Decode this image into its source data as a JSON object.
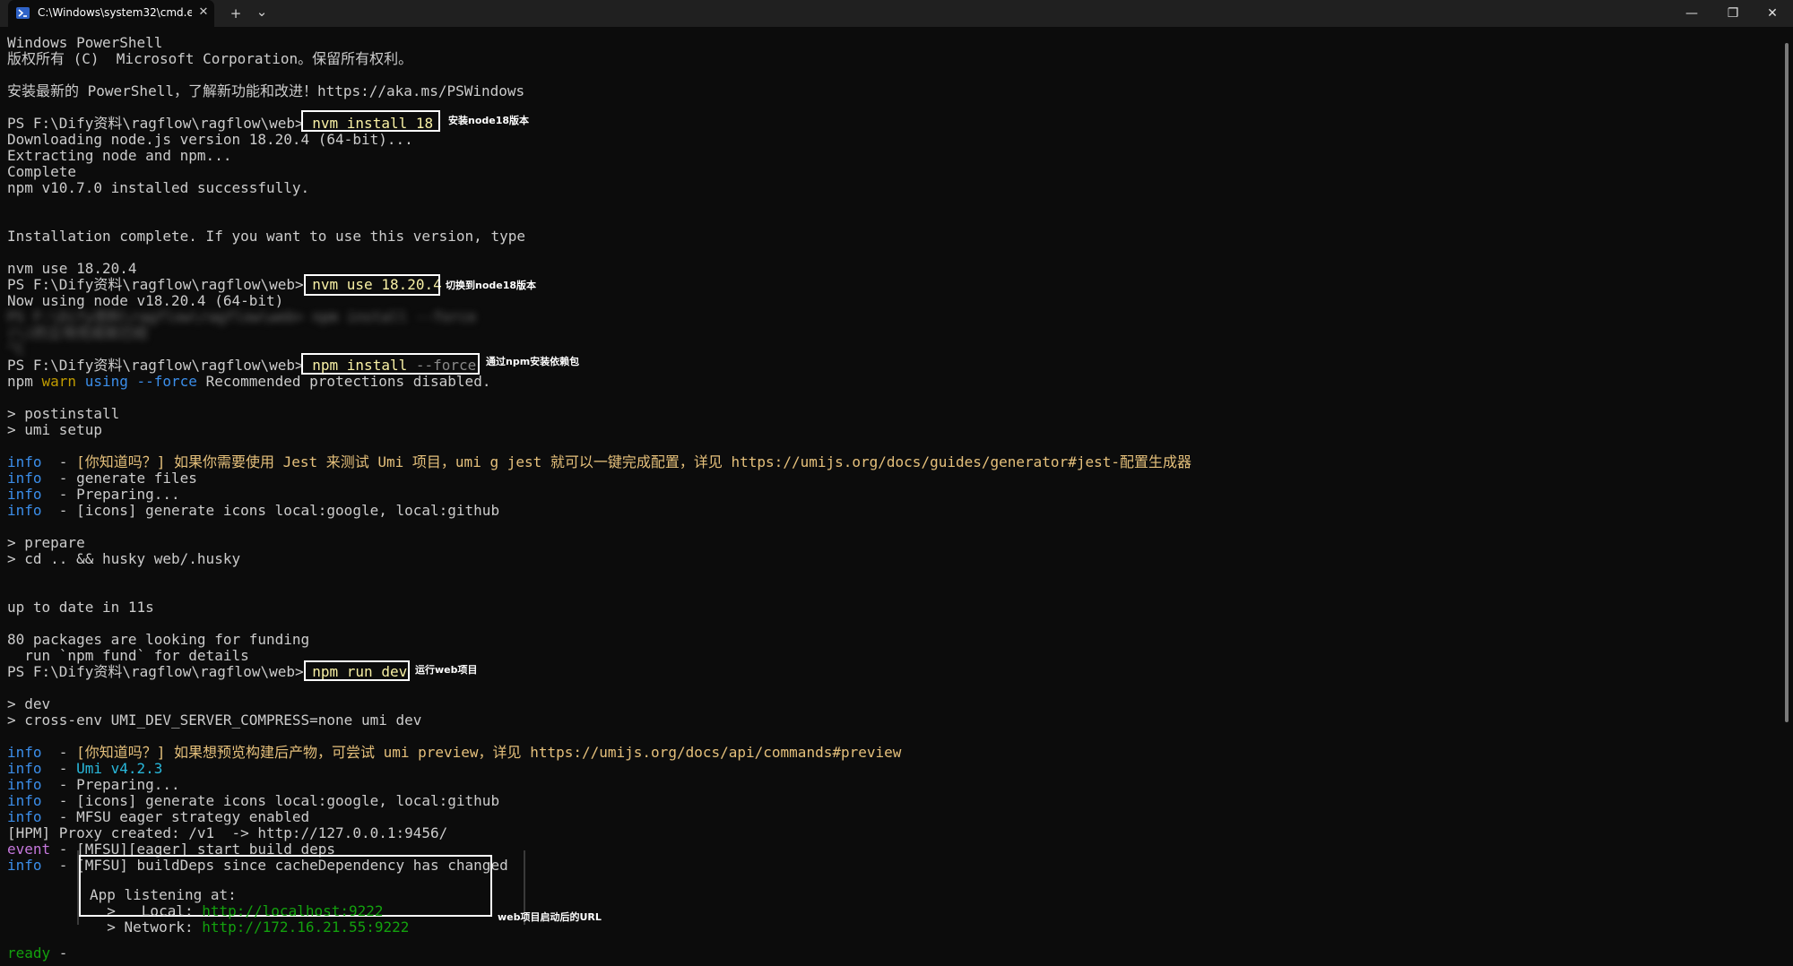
{
  "tab": {
    "title": "C:\\Windows\\system32\\cmd.e:",
    "close_glyph": "✕",
    "new_tab_glyph": "+",
    "dropdown_glyph": "⌄"
  },
  "window_controls": {
    "minimize": "—",
    "restore": "❐",
    "close": "✕"
  },
  "terminal": {
    "header": {
      "line1": "Windows PowerShell",
      "line2": "版权所有 (C)  Microsoft Corporation。保留所有权利。",
      "line3": "安装最新的 PowerShell，了解新功能和改进！https://aka.ms/PSWindows"
    },
    "prompt": "PS F:\\Dify资料\\ragflow\\ragflow\\web>",
    "cmd1": {
      "command": " nvm install 18",
      "annotation": "安装node18版本"
    },
    "nvm_output": [
      "Downloading node.js version 18.20.4 (64-bit)...",
      "Extracting node and npm...",
      "Complete",
      "npm v10.7.0 installed successfully."
    ],
    "install_complete": "Installation complete. If you want to use this version, type",
    "nvm_use_line": "nvm use 18.20.4",
    "cmd2": {
      "command": " nvm use 18.20.4",
      "annotation": "切换到node18版本"
    },
    "now_using": "Now using node v18.20.4 (64-bit)",
    "cmd3": {
      "command": " npm install",
      "flag": " --force",
      "annotation": "通过npm安装依赖包"
    },
    "npm_warn": {
      "npm": "npm ",
      "warn": "warn ",
      "using": "using ",
      "force": "--force",
      "rest": " Recommended protections disabled."
    },
    "postinstall": [
      "> postinstall",
      "> umi setup"
    ],
    "info_label": "info",
    "info_sep": "  - ",
    "setup_info": {
      "tip": "[你知道吗？] 如果你需要使用 Jest 来测试 Umi 项目，umi g jest 就可以一键完成配置，详见 https://umijs.org/docs/guides/generator#jest-配置生成器",
      "generate": "generate files",
      "preparing": "Preparing...",
      "icons": "[icons] generate icons local:google, local:github"
    },
    "prepare": [
      "> prepare",
      "> cd .. && husky web/.husky"
    ],
    "up_to_date": "up to date in 11s",
    "funding": [
      "80 packages are looking for funding",
      "  run `npm fund` for details"
    ],
    "cmd4": {
      "command": " npm run dev",
      "annotation": "运行web项目"
    },
    "dev": [
      "> dev",
      "> cross-env UMI_DEV_SERVER_COMPRESS=none umi dev"
    ],
    "dev_info": {
      "tip": "[你知道吗？] 如果想预览构建后产物，可尝试 umi preview，详见 https://umijs.org/docs/api/commands#preview",
      "umi_version": "Umi v4.2.3",
      "preparing": "Preparing...",
      "icons": "[icons] generate icons local:google, local:github",
      "mfsu": "MFSU eager strategy enabled"
    },
    "hpm": "[HPM] Proxy created: /v1  -> http://127.0.0.1:9456/",
    "event": {
      "label": "event",
      "text": " - [MFSU][eager] start build deps"
    },
    "build_deps": "[MFSU] buildDeps since cacheDependency has changed",
    "banner": {
      "title": "App listening at:",
      "local_label": "  >   Local: ",
      "local_url": "http://localhost:9222",
      "network_label": "  > Network: ",
      "network_url": "http://172.16.21.55:9222",
      "annotation": "web项目启动后的URL"
    },
    "ready": {
      "label": "ready",
      "sep": " -"
    }
  },
  "colors": {
    "background": "#0c0c0c",
    "text": "#cccccc",
    "info": "#3b8eea",
    "warn": "#c19c00",
    "tip": "#e5c07b",
    "url": "#13a10e",
    "event": "#c678dd",
    "annotation_box": "#ffffff"
  }
}
